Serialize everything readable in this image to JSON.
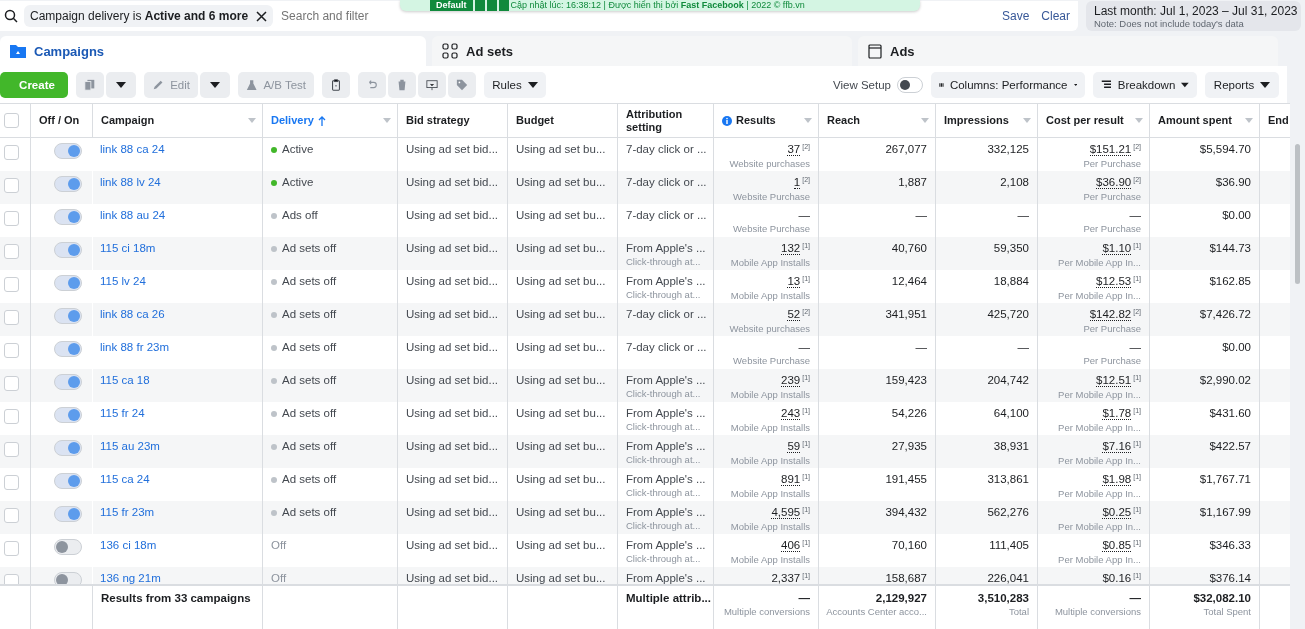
{
  "filter_bar": {
    "chip": "Campaign delivery is **Active and 6 more**",
    "placeholder": "Search and filter",
    "save": "Save",
    "clear": "Clear"
  },
  "date_range": {
    "label": "Last month: Jul 1, 2023 – Jul 31, 2023",
    "note": "Note: Does not include today's data"
  },
  "extension_banner": {
    "preset": "Default",
    "text": "Cập nhật lúc: 16:38:12 | Được hiển thị bởi **Fast Facebook** | 2022 © ffb.vn"
  },
  "tabs": [
    {
      "label": "Campaigns",
      "selected": true
    },
    {
      "label": "Ad sets",
      "selected": false
    },
    {
      "label": "Ads",
      "selected": false
    }
  ],
  "toolbar": {
    "create": "Create",
    "edit": "Edit",
    "ab_test": "A/B Test",
    "rules": "Rules",
    "view_setup": "View Setup",
    "view_setup_on": false,
    "columns": "Columns: Performance",
    "breakdown": "Breakdown",
    "reports": "Reports"
  },
  "table": {
    "all_selected": false,
    "columns": [
      {
        "label": "Off / On",
        "sorted": false
      },
      {
        "label": "Campaign",
        "sorted": false
      },
      {
        "label": "Delivery",
        "sorted": true
      },
      {
        "label": "Bid strategy",
        "sorted": false
      },
      {
        "label": "Budget",
        "sorted": false
      },
      {
        "label": "Attribution setting",
        "sorted": false
      },
      {
        "label": "Results",
        "sorted": false
      },
      {
        "label": "Reach",
        "sorted": false
      },
      {
        "label": "Impressions",
        "sorted": false
      },
      {
        "label": "Cost per result",
        "sorted": false
      },
      {
        "label": "Amount spent",
        "sorted": false
      },
      {
        "label": "End",
        "sorted": false
      }
    ],
    "rows": [
      {
        "selected": false,
        "on": true,
        "name": "link 88 ca 24",
        "delivery": "Active",
        "color": "#42b72a",
        "bid": "Using ad set bid...",
        "budget": "Using ad set bu...",
        "attribution": "7-day click or ...",
        "results": "37",
        "results_note": "[2]",
        "results_label": "Website purchases",
        "reach": "267,077",
        "impressions": "332,125",
        "cost": "$151.21",
        "cost_note": "[2]",
        "cost_label": "Per Purchase",
        "spent": "$5,594.70"
      },
      {
        "selected": false,
        "on": true,
        "name": "link 88 lv 24",
        "delivery": "Active",
        "color": "#42b72a",
        "bid": "Using ad set bid...",
        "budget": "Using ad set bu...",
        "attribution": "7-day click or ...",
        "results": "1",
        "results_note": "[2]",
        "results_label": "Website Purchase",
        "reach": "1,887",
        "impressions": "2,108",
        "cost": "$36.90",
        "cost_note": "[2]",
        "cost_label": "Per Purchase",
        "spent": "$36.90"
      },
      {
        "selected": false,
        "on": true,
        "name": "link 88 au 24",
        "delivery": "Ads off",
        "color": "#bec3c9",
        "bid": "Using ad set bid...",
        "budget": "Using ad set bu...",
        "attribution": "7-day click or ...",
        "results": "—",
        "results_label": "Website Purchase",
        "reach": "—",
        "impressions": "—",
        "cost": "—",
        "cost_label": "Per Purchase",
        "spent": "$0.00"
      },
      {
        "selected": false,
        "on": true,
        "name": "115 ci 18m",
        "delivery": "Ad sets off",
        "color": "#bec3c9",
        "bid": "Using ad set bid...",
        "budget": "Using ad set bu...",
        "attribution": "From Apple's ...",
        "attribution_sub": "Click-through at...",
        "results": "132",
        "results_note": "[1]",
        "results_label": "Mobile App Installs",
        "reach": "40,760",
        "impressions": "59,350",
        "cost": "$1.10",
        "cost_note": "[1]",
        "cost_label": "Per Mobile App In...",
        "spent": "$144.73"
      },
      {
        "selected": false,
        "on": true,
        "name": "115 lv 24",
        "delivery": "Ad sets off",
        "color": "#bec3c9",
        "bid": "Using ad set bid...",
        "budget": "Using ad set bu...",
        "attribution": "From Apple's ...",
        "attribution_sub": "Click-through at...",
        "results": "13",
        "results_note": "[1]",
        "results_label": "Mobile App Installs",
        "reach": "12,464",
        "impressions": "18,884",
        "cost": "$12.53",
        "cost_note": "[1]",
        "cost_label": "Per Mobile App In...",
        "spent": "$162.85"
      },
      {
        "selected": false,
        "on": true,
        "name": "link 88 ca 26",
        "delivery": "Ad sets off",
        "color": "#bec3c9",
        "bid": "Using ad set bid...",
        "budget": "Using ad set bu...",
        "attribution": "7-day click or ...",
        "results": "52",
        "results_note": "[2]",
        "results_label": "Website purchases",
        "reach": "341,951",
        "impressions": "425,720",
        "cost": "$142.82",
        "cost_note": "[2]",
        "cost_label": "Per Purchase",
        "spent": "$7,426.72"
      },
      {
        "selected": false,
        "on": true,
        "name": "link 88 fr 23m",
        "delivery": "Ad sets off",
        "color": "#bec3c9",
        "bid": "Using ad set bid...",
        "budget": "Using ad set bu...",
        "attribution": "7-day click or ...",
        "results": "—",
        "results_label": "Website Purchase",
        "reach": "—",
        "impressions": "—",
        "cost": "—",
        "cost_label": "Per Purchase",
        "spent": "$0.00"
      },
      {
        "selected": false,
        "on": true,
        "name": "115 ca 18",
        "delivery": "Ad sets off",
        "color": "#bec3c9",
        "bid": "Using ad set bid...",
        "budget": "Using ad set bu...",
        "attribution": "From Apple's ...",
        "attribution_sub": "Click-through at...",
        "results": "239",
        "results_note": "[1]",
        "results_label": "Mobile App Installs",
        "reach": "159,423",
        "impressions": "204,742",
        "cost": "$12.51",
        "cost_note": "[1]",
        "cost_label": "Per Mobile App In...",
        "spent": "$2,990.02"
      },
      {
        "selected": false,
        "on": true,
        "name": "115 fr 24",
        "delivery": "Ad sets off",
        "color": "#bec3c9",
        "bid": "Using ad set bid...",
        "budget": "Using ad set bu...",
        "attribution": "From Apple's ...",
        "attribution_sub": "Click-through at...",
        "results": "243",
        "results_note": "[1]",
        "results_label": "Mobile App Installs",
        "reach": "54,226",
        "impressions": "64,100",
        "cost": "$1.78",
        "cost_note": "[1]",
        "cost_label": "Per Mobile App In...",
        "spent": "$431.60"
      },
      {
        "selected": false,
        "on": true,
        "name": "115 au 23m",
        "delivery": "Ad sets off",
        "color": "#bec3c9",
        "bid": "Using ad set bid...",
        "budget": "Using ad set bu...",
        "attribution": "From Apple's ...",
        "attribution_sub": "Click-through at...",
        "results": "59",
        "results_note": "[1]",
        "results_label": "Mobile App Installs",
        "reach": "27,935",
        "impressions": "38,931",
        "cost": "$7.16",
        "cost_note": "[1]",
        "cost_label": "Per Mobile App In...",
        "spent": "$422.57"
      },
      {
        "selected": false,
        "on": true,
        "name": "115 ca 24",
        "delivery": "Ad sets off",
        "color": "#bec3c9",
        "bid": "Using ad set bid...",
        "budget": "Using ad set bu...",
        "attribution": "From Apple's ...",
        "attribution_sub": "Click-through at...",
        "results": "891",
        "results_note": "[1]",
        "results_label": "Mobile App Installs",
        "reach": "191,455",
        "impressions": "313,861",
        "cost": "$1.98",
        "cost_note": "[1]",
        "cost_label": "Per Mobile App In...",
        "spent": "$1,767.71"
      },
      {
        "selected": false,
        "on": true,
        "name": "115 fr 23m",
        "delivery": "Ad sets off",
        "color": "#bec3c9",
        "bid": "Using ad set bid...",
        "budget": "Using ad set bu...",
        "attribution": "From Apple's ...",
        "attribution_sub": "Click-through at...",
        "results": "4,595",
        "results_note": "[1]",
        "results_label": "Mobile App Installs",
        "reach": "394,432",
        "impressions": "562,276",
        "cost": "$0.25",
        "cost_note": "[1]",
        "cost_label": "Per Mobile App In...",
        "spent": "$1,167.99"
      },
      {
        "selected": false,
        "on": false,
        "name": "136 ci 18m",
        "delivery": "Off",
        "bid": "Using ad set bid...",
        "budget": "Using ad set bu...",
        "attribution": "From Apple's ...",
        "attribution_sub": "Click-through at...",
        "results": "406",
        "results_note": "[1]",
        "results_label": "Mobile App Installs",
        "reach": "70,160",
        "impressions": "111,405",
        "cost": "$0.85",
        "cost_note": "[1]",
        "cost_label": "Per Mobile App In...",
        "spent": "$346.33"
      },
      {
        "selected": false,
        "on": false,
        "name": "136 ng 21m",
        "delivery": "Off",
        "bid": "Using ad set bid...",
        "budget": "Using ad set bu...",
        "attribution": "From Apple's ...",
        "results": "2,337",
        "results_note": "[1]",
        "reach": "158,687",
        "impressions": "226,041",
        "cost": "$0.16",
        "cost_note": "[1]",
        "spent": "$376.14"
      }
    ],
    "summary": {
      "campaign": "Results from 33 campaigns",
      "attribution": "Multiple attrib...",
      "results": "—",
      "results_label": "Multiple conversions",
      "reach": "2,129,927",
      "reach_label": "Accounts Center acco...",
      "impressions": "3,510,283",
      "impressions_label": "Total",
      "cost": "—",
      "cost_label": "Multiple conversions",
      "spent": "$32,082.10",
      "spent_label": "Total Spent"
    }
  }
}
